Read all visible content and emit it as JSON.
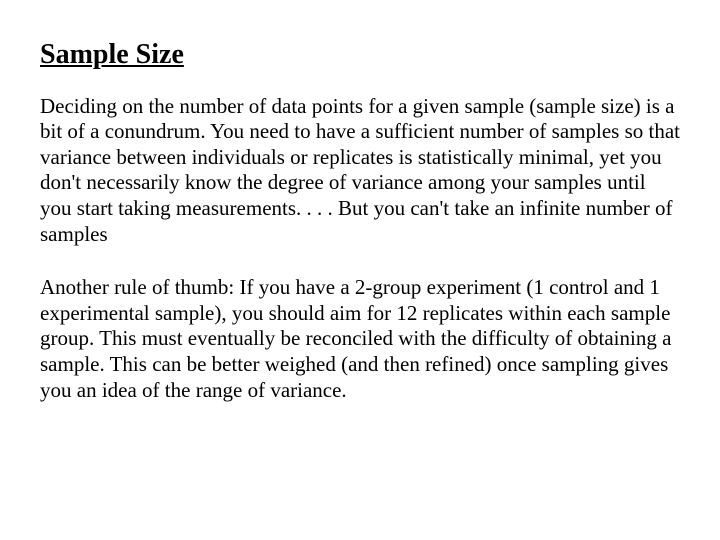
{
  "heading": "Sample Size",
  "paragraph1": "Deciding on the number of data points for a given sample (sample size) is a bit of a conundrum.  You need to have a sufficient number of samples so that variance between individuals or replicates is statistically minimal, yet you don't necessarily know the degree of variance among your samples until you start taking measurements. . . . But you can't take an infinite number of samples",
  "paragraph2": "Another rule of thumb:  If you have a 2-group experiment (1 control and 1 experimental sample), you should aim for 12 replicates within each sample group.  This must eventually be reconciled with the difficulty of obtaining a sample.  This can be better weighed (and then refined) once sampling gives you an idea of the range of variance."
}
